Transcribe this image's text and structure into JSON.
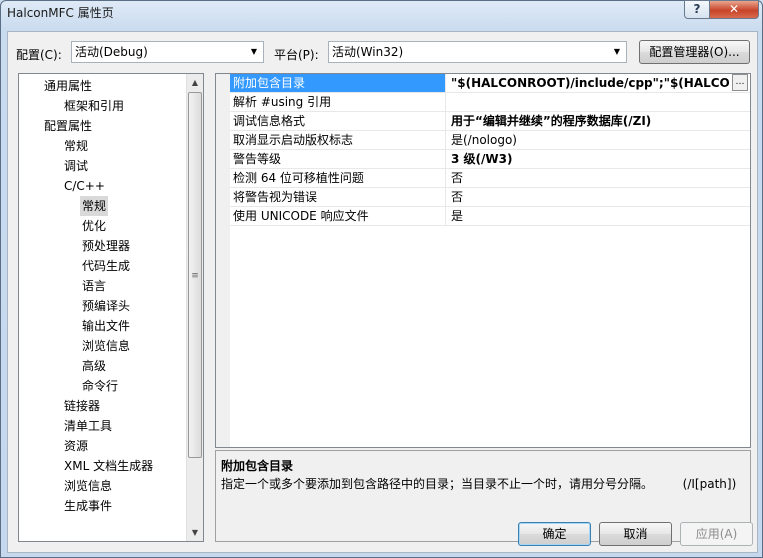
{
  "window": {
    "title": "HalconMFC 属性页",
    "help_symbol": "?",
    "close_symbol": "✕"
  },
  "config": {
    "label": "配置(C):",
    "value": "活动(Debug)",
    "platform_label": "平台(P):",
    "platform_value": "活动(Win32)",
    "manager_button": "配置管理器(O)..."
  },
  "tree": {
    "items": [
      {
        "label": "通用属性"
      },
      {
        "label": "框架和引用"
      },
      {
        "label": "配置属性"
      },
      {
        "label": "常规"
      },
      {
        "label": "调试"
      },
      {
        "label": "C/C++"
      },
      {
        "label": "常规"
      },
      {
        "label": "优化"
      },
      {
        "label": "预处理器"
      },
      {
        "label": "代码生成"
      },
      {
        "label": "语言"
      },
      {
        "label": "预编译头"
      },
      {
        "label": "输出文件"
      },
      {
        "label": "浏览信息"
      },
      {
        "label": "高级"
      },
      {
        "label": "命令行"
      },
      {
        "label": "链接器"
      },
      {
        "label": "清单工具"
      },
      {
        "label": "资源"
      },
      {
        "label": "XML 文档生成器"
      },
      {
        "label": "浏览信息"
      },
      {
        "label": "生成事件"
      }
    ]
  },
  "properties": [
    {
      "name": "附加包含目录",
      "value": "\"$(HALCONROOT)/include/cpp\";\"$(HALCONRO"
    },
    {
      "name": "解析 #using 引用",
      "value": ""
    },
    {
      "name": "调试信息格式",
      "value": "用于“编辑并继续”的程序数据库(/ZI)"
    },
    {
      "name": "取消显示启动版权标志",
      "value": "是(/nologo)"
    },
    {
      "name": "警告等级",
      "value": "3 级(/W3)"
    },
    {
      "name": "检测 64 位可移植性问题",
      "value": "否"
    },
    {
      "name": "将警告视为错误",
      "value": "否"
    },
    {
      "name": "使用 UNICODE 响应文件",
      "value": "是"
    }
  ],
  "description": {
    "title": "附加包含目录",
    "text": "指定一个或多个要添加到包含路径中的目录；当目录不止一个时，请用分号分隔。",
    "switch": "(/I[path])"
  },
  "buttons": {
    "ok": "确定",
    "cancel": "取消",
    "apply": "应用(A)"
  },
  "colors": {
    "selection": "#3399ff",
    "title_gradient": "#c9dbef",
    "close_button": "#c8442a"
  }
}
